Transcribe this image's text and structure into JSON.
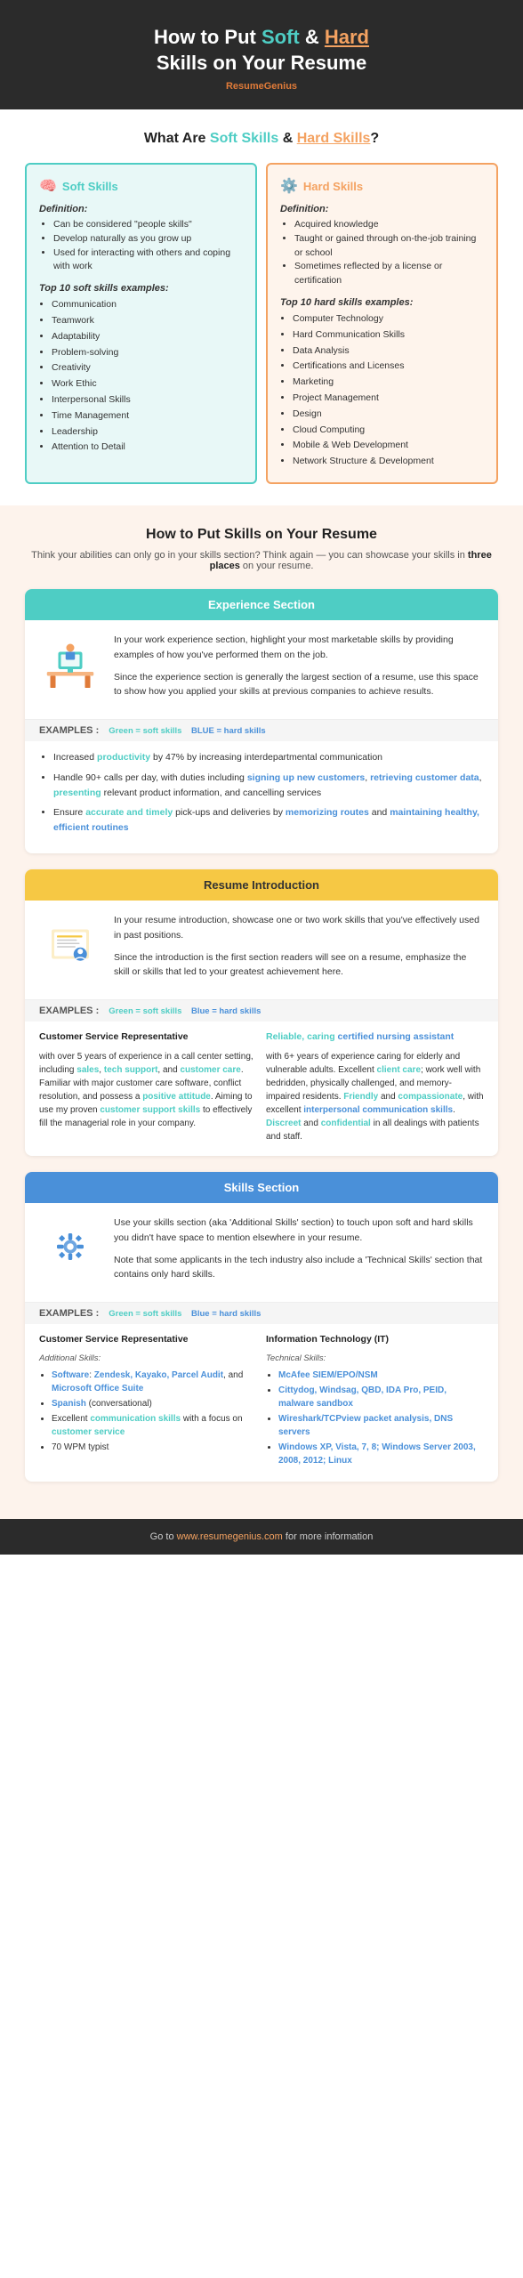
{
  "header": {
    "title_part1": "How to Put ",
    "title_soft": "Soft",
    "title_middle": " & ",
    "title_hard": "Hard",
    "title_part2": " Skills on Your Resume",
    "brand_text": "Resume",
    "brand_highlight": "Genius"
  },
  "what_are": {
    "title_static": "What Are ",
    "title_soft": "Soft Skills",
    "title_mid": " & ",
    "title_hard": "Hard Skills",
    "title_end": "?",
    "soft": {
      "label": "Soft Skills",
      "icon": "🧠",
      "definition_label": "Definition:",
      "definition_items": [
        "Can be considered \"people skills\"",
        "Develop naturally as you grow up",
        "Used for interacting with others and coping with work"
      ],
      "examples_label": "Top 10 soft skills examples:",
      "examples": [
        "Communication",
        "Teamwork",
        "Adaptability",
        "Problem-solving",
        "Creativity",
        "Work Ethic",
        "Interpersonal Skills",
        "Time Management",
        "Leadership",
        "Attention to Detail"
      ]
    },
    "hard": {
      "label": "Hard Skills",
      "icon": "⚙️",
      "definition_label": "Definition:",
      "definition_items": [
        "Acquired knowledge",
        "Taught or gained through on-the-job training or school",
        "Sometimes reflected by a license or certification"
      ],
      "examples_label": "Top 10 hard skills examples:",
      "examples": [
        "Computer Technology",
        "Hard Communication Skills",
        "Data Analysis",
        "Certifications and Licenses",
        "Marketing",
        "Project Management",
        "Design",
        "Cloud Computing",
        "Mobile & Web Development",
        "Network Structure & Development"
      ]
    }
  },
  "how_to": {
    "title": "How to Put Skills on Your Resume",
    "subtitle": "Think your abilities can only go in your skills section? Think again — you can showcase your skills in",
    "subtitle_bold": "three places",
    "subtitle_end": "on your resume.",
    "experience": {
      "header": "Experience Section",
      "body1": "In your work experience section, highlight your most marketable skills by providing examples of how you've performed them on the job.",
      "body2": "Since the experience section is generally the largest section of a resume, use this space to show how you applied your skills at previous companies to achieve results.",
      "examples_label": "EXAMPLES :",
      "legend_soft": "Green = soft skills",
      "legend_hard": "BLUE = hard skills",
      "bullets": [
        {
          "parts": [
            {
              "text": "Increased ",
              "style": "normal"
            },
            {
              "text": "productivity",
              "style": "green"
            },
            {
              "text": " by 47% by increasing interdepartmental communication",
              "style": "normal"
            }
          ]
        },
        {
          "parts": [
            {
              "text": "Handle 90+ calls per day, with duties including ",
              "style": "normal"
            },
            {
              "text": "signing up new customers",
              "style": "blue"
            },
            {
              "text": ", ",
              "style": "normal"
            },
            {
              "text": "retrieving customer data",
              "style": "blue"
            },
            {
              "text": ", ",
              "style": "normal"
            },
            {
              "text": "presenting",
              "style": "green"
            },
            {
              "text": " relevant product information, and cancelling services",
              "style": "normal"
            }
          ]
        },
        {
          "parts": [
            {
              "text": "Ensure ",
              "style": "normal"
            },
            {
              "text": "accurate and timely",
              "style": "green"
            },
            {
              "text": " pick-ups and deliveries by ",
              "style": "normal"
            },
            {
              "text": "memorizing routes",
              "style": "blue"
            },
            {
              "text": " and ",
              "style": "normal"
            },
            {
              "text": "maintaining healthy, efficient routines",
              "style": "blue"
            }
          ]
        }
      ]
    },
    "introduction": {
      "header": "Resume Introduction",
      "body1": "In your resume introduction, showcase one or two work skills that you've effectively used in past positions.",
      "body2": "Since the introduction is the first section readers will see on a resume, emphasize the skill or skills that led to your greatest achievement here.",
      "examples_label": "EXAMPLES :",
      "legend_soft": "Green = soft skills",
      "legend_hard": "Blue = hard skills",
      "left_title": "Customer Service Representative",
      "left_body": "with over 5 years of experience in a call center setting, including sales, tech support, and customer care. Familiar with major customer care software, conflict resolution, and possess a positive attitude. Aiming to use my proven customer support skills to effectively fill the managerial role in your company.",
      "right_title": "Reliable, caring certified nursing assistant",
      "right_body": "with 6+ years of experience caring for elderly and vulnerable adults. Excellent client care; work well with bedridden, physically challenged, and memory-impaired residents. Friendly and compassionate, with excellent interpersonal communication skills. Discreet and confidential in all dealings with patients and staff."
    },
    "skills_section": {
      "header": "Skills Section",
      "body1": "Use your skills section (aka 'Additional Skills' section) to touch upon soft and hard skills you didn't have space to mention elsewhere in your resume.",
      "body2": "Note that some applicants in the tech industry also include a 'Technical Skills' section that contains only hard skills.",
      "examples_label": "EXAMPLES :",
      "legend_soft": "Green = soft skills",
      "legend_hard": "Blue = hard skills",
      "left": {
        "title": "Customer Service Representative",
        "subtitle_additional": "Additional Skills:",
        "items": [
          "Software: Zendesk, Kayako, Parcel Audit, and Microsoft Office Suite",
          "Spanish (conversational)",
          "Excellent communication skills with a focus on customer service",
          "70 WPM typist"
        ]
      },
      "right": {
        "title": "Information Technology (IT)",
        "subtitle_technical": "Technical Skills:",
        "items": [
          "McAfee SIEM/EPO/NSM",
          "Cittydog, Windsag, QBD, IDA Pro, PEID, malware sandbox",
          "Wireshark/TCPview packet analysis, DNS servers",
          "Windows XP, Vista, 7, 8; Windows Server 2003, 2008, 2012; Linux"
        ]
      }
    }
  },
  "footer": {
    "text": "Go to ",
    "link": "www.resumegenius.com",
    "text_end": " for more information"
  }
}
